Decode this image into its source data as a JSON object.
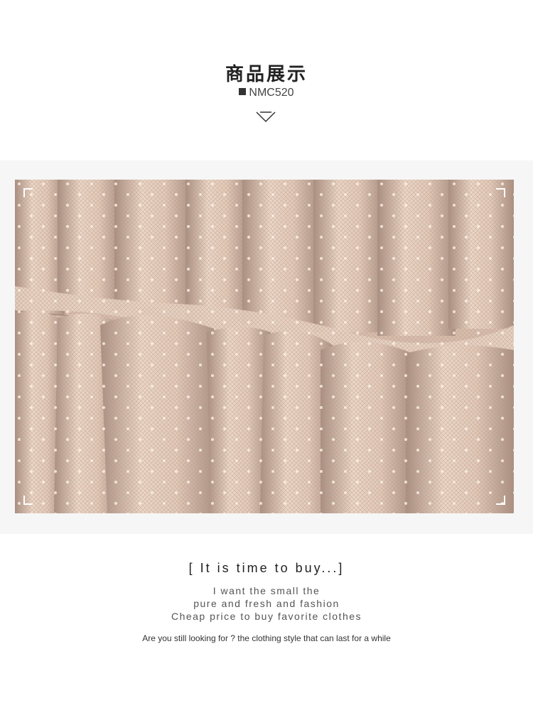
{
  "header": {
    "title": "商品展示",
    "code": "NMC520",
    "arrow_icon": "chevron-down-icon"
  },
  "photo": {
    "subject": "pink tulle mesh fabric with small white dots",
    "colors": {
      "base": "#d8bcac",
      "light": "#ecd6c6",
      "shadow": "#a98e80",
      "dot": "#fbf3ea"
    }
  },
  "caption": {
    "tagline": "[ It is time to buy...]",
    "lines": [
      "I want the small the",
      "pure and fresh and fashion",
      "Cheap price to buy favorite clothes"
    ],
    "small": "Are you still looking for ? the clothing style that can last for a while"
  }
}
